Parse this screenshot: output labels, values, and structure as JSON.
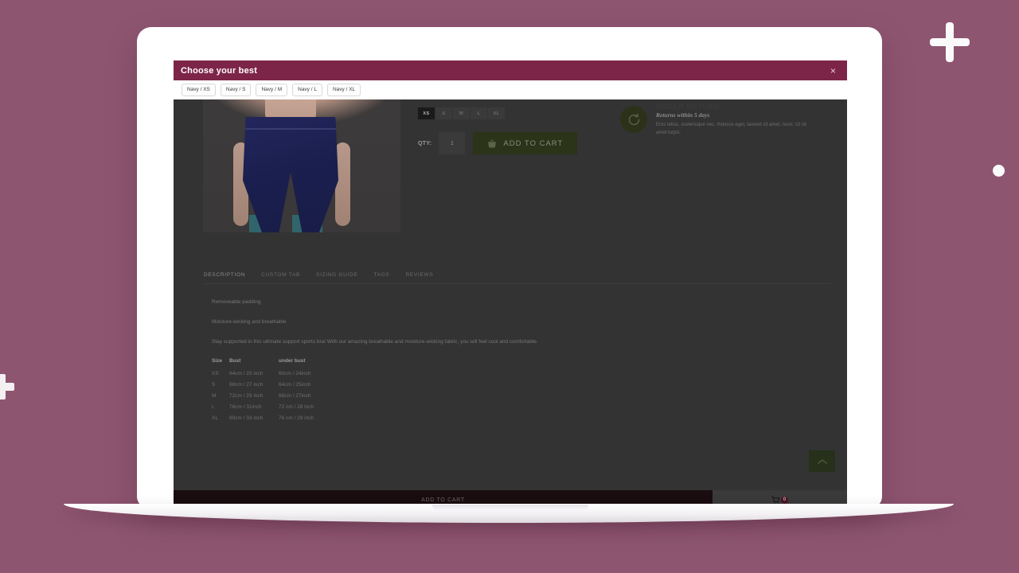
{
  "modal": {
    "title": "Choose your best",
    "close_label": "×"
  },
  "variants": [
    {
      "label": "Navy / XS"
    },
    {
      "label": "Navy / S"
    },
    {
      "label": "Navy / M"
    },
    {
      "label": "Navy / L"
    },
    {
      "label": "Navy / XL"
    }
  ],
  "product": {
    "sizes": [
      {
        "label": "XS",
        "selected": true
      },
      {
        "label": "S",
        "selected": false
      },
      {
        "label": "M",
        "selected": false
      },
      {
        "label": "L",
        "selected": false
      },
      {
        "label": "XL",
        "selected": false
      }
    ],
    "qty_label": "QTY:",
    "qty_value": "1",
    "add_to_cart_label": "ADD TO CART"
  },
  "returns": {
    "eyebrow": "ORDER RETURN",
    "title": "Returns within 5 days",
    "body": "Eros tellus, scelerisque nec, rhoncus eget, laoreet sit amet, nunc. Ut sit amet turpis."
  },
  "tabs": [
    {
      "label": "DESCRIPTION",
      "active": true
    },
    {
      "label": "CUSTOM TAB",
      "active": false
    },
    {
      "label": "SIZING GUIDE",
      "active": false
    },
    {
      "label": "TAGS",
      "active": false
    },
    {
      "label": "REVIEWS",
      "active": false
    }
  ],
  "description": {
    "line1": "Removeable padding",
    "line2": "Moisture-wicking and breathable",
    "line3": "Stay supported in this ultimate support sports bra! With our amazing breathable and moisture-wicking fabric, you will feel cool and comfortable."
  },
  "size_table": {
    "headers": [
      "Size",
      "Bust",
      "under bust"
    ],
    "rows": [
      [
        "XS",
        "64cm / 25 inch",
        "60cm / 24inch"
      ],
      [
        "S",
        "68cm / 27 inch",
        "64cm / 25inch"
      ],
      [
        "M",
        "72cm / 29 inch",
        "68cm / 27inch"
      ],
      [
        "L",
        "76cm / 31inch",
        "72 cm / 28 inch"
      ],
      [
        "XL",
        "80cm / 33 inch",
        "76 cm / 29 inch"
      ]
    ]
  },
  "sticky": {
    "add_to_cart_label": "ADD TO CART",
    "cart_count": "0"
  },
  "colors": {
    "background": "#8e5570",
    "modal_header": "#7d2548",
    "page_overlay": "#333333",
    "accent_green": "#2b3318",
    "sticky_dark": "#190d10"
  }
}
